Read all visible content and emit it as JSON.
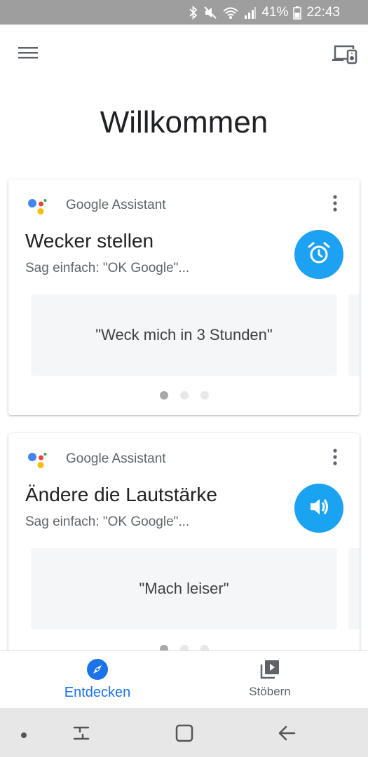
{
  "status_bar": {
    "battery": "41%",
    "time": "22:43",
    "icons": [
      "bluetooth-icon",
      "mute-icon",
      "wifi-icon",
      "signal-icon",
      "battery-icon"
    ]
  },
  "app_bar": {
    "menu_icon": "hamburger-menu-icon",
    "cast_icon": "devices-icon"
  },
  "page_title": "Willkommen",
  "cards": [
    {
      "source": "Google Assistant",
      "title": "Wecker stellen",
      "subtitle": "Sag einfach: \"OK Google\"...",
      "action_icon": "alarm-clock-icon",
      "suggestion": "\"Weck mich in 3 Stunden\"",
      "pager_active": 1,
      "pager_total": 3
    },
    {
      "source": "Google Assistant",
      "title": "Ändere die Lautstärke",
      "subtitle": "Sag einfach: \"OK Google\"...",
      "action_icon": "volume-icon",
      "suggestion": "\"Mach leiser\"",
      "pager_active": 1,
      "pager_total": 3
    }
  ],
  "bottom_nav": {
    "items": [
      {
        "label": "Entdecken",
        "icon": "compass-icon",
        "active": true
      },
      {
        "label": "Stöbern",
        "icon": "media-library-icon",
        "active": false
      }
    ]
  },
  "colors": {
    "accent": "#1a73e8",
    "action_circle": "#1da1f2",
    "google_blue": "#4285f4",
    "google_red": "#ea4335",
    "google_yellow": "#fbbc05",
    "google_green": "#34a853"
  }
}
